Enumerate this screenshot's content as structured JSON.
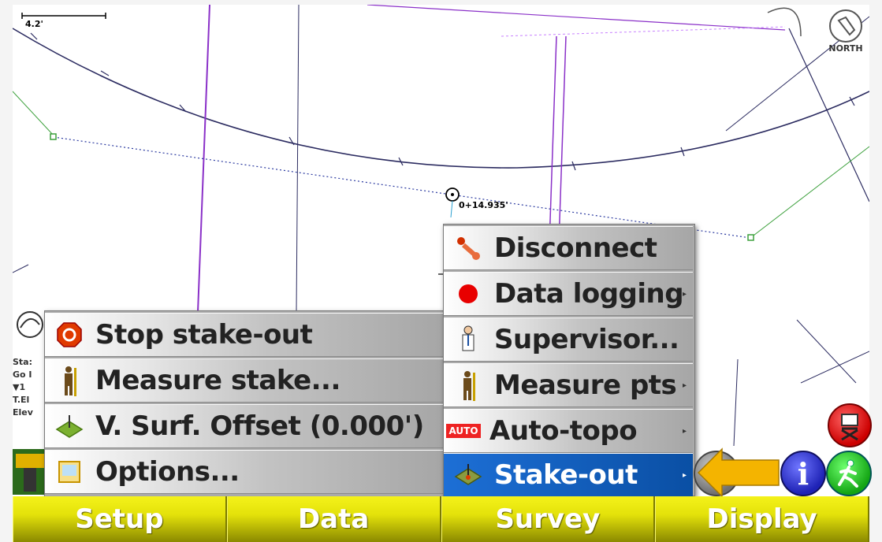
{
  "map": {
    "scale_label": "4.2'",
    "north_label": "NORTH",
    "station_label": "0+14.935'"
  },
  "status": {
    "line1": "Sta:",
    "line2": "Go I",
    "line3": "▼1",
    "line4": "T.El",
    "line5": "Elev"
  },
  "stakeout_submenu": {
    "items": [
      {
        "label": "Stop stake-out",
        "icon": "stop-icon"
      },
      {
        "label": "Measure stake...",
        "icon": "surveyor-icon"
      },
      {
        "label": "V. Surf. Offset (0.000')",
        "icon": "surface-icon"
      },
      {
        "label": "Options...",
        "icon": "options-icon"
      }
    ]
  },
  "survey_menu": {
    "items": [
      {
        "label": "Disconnect",
        "icon": "disconnect-icon",
        "has_submenu": false
      },
      {
        "label": "Data logging",
        "icon": "record-icon",
        "has_submenu": true
      },
      {
        "label": "Supervisor...",
        "icon": "supervisor-icon",
        "has_submenu": false
      },
      {
        "label": "Measure pts",
        "icon": "surveyor-icon",
        "has_submenu": true
      },
      {
        "label": "Auto-topo",
        "icon": "auto-icon",
        "has_submenu": true,
        "badge": "AUTO"
      },
      {
        "label": "Stake-out",
        "icon": "stakeout-icon",
        "has_submenu": true,
        "selected": true
      }
    ]
  },
  "bottom_bar": {
    "tabs": [
      "Setup",
      "Data",
      "Survey",
      "Display"
    ]
  },
  "colors": {
    "menu_selected": "#0a4fa4",
    "bottom_bar": "#e4e20a",
    "alignment_line": "#8a30c8",
    "arrow": "#f4b400"
  }
}
